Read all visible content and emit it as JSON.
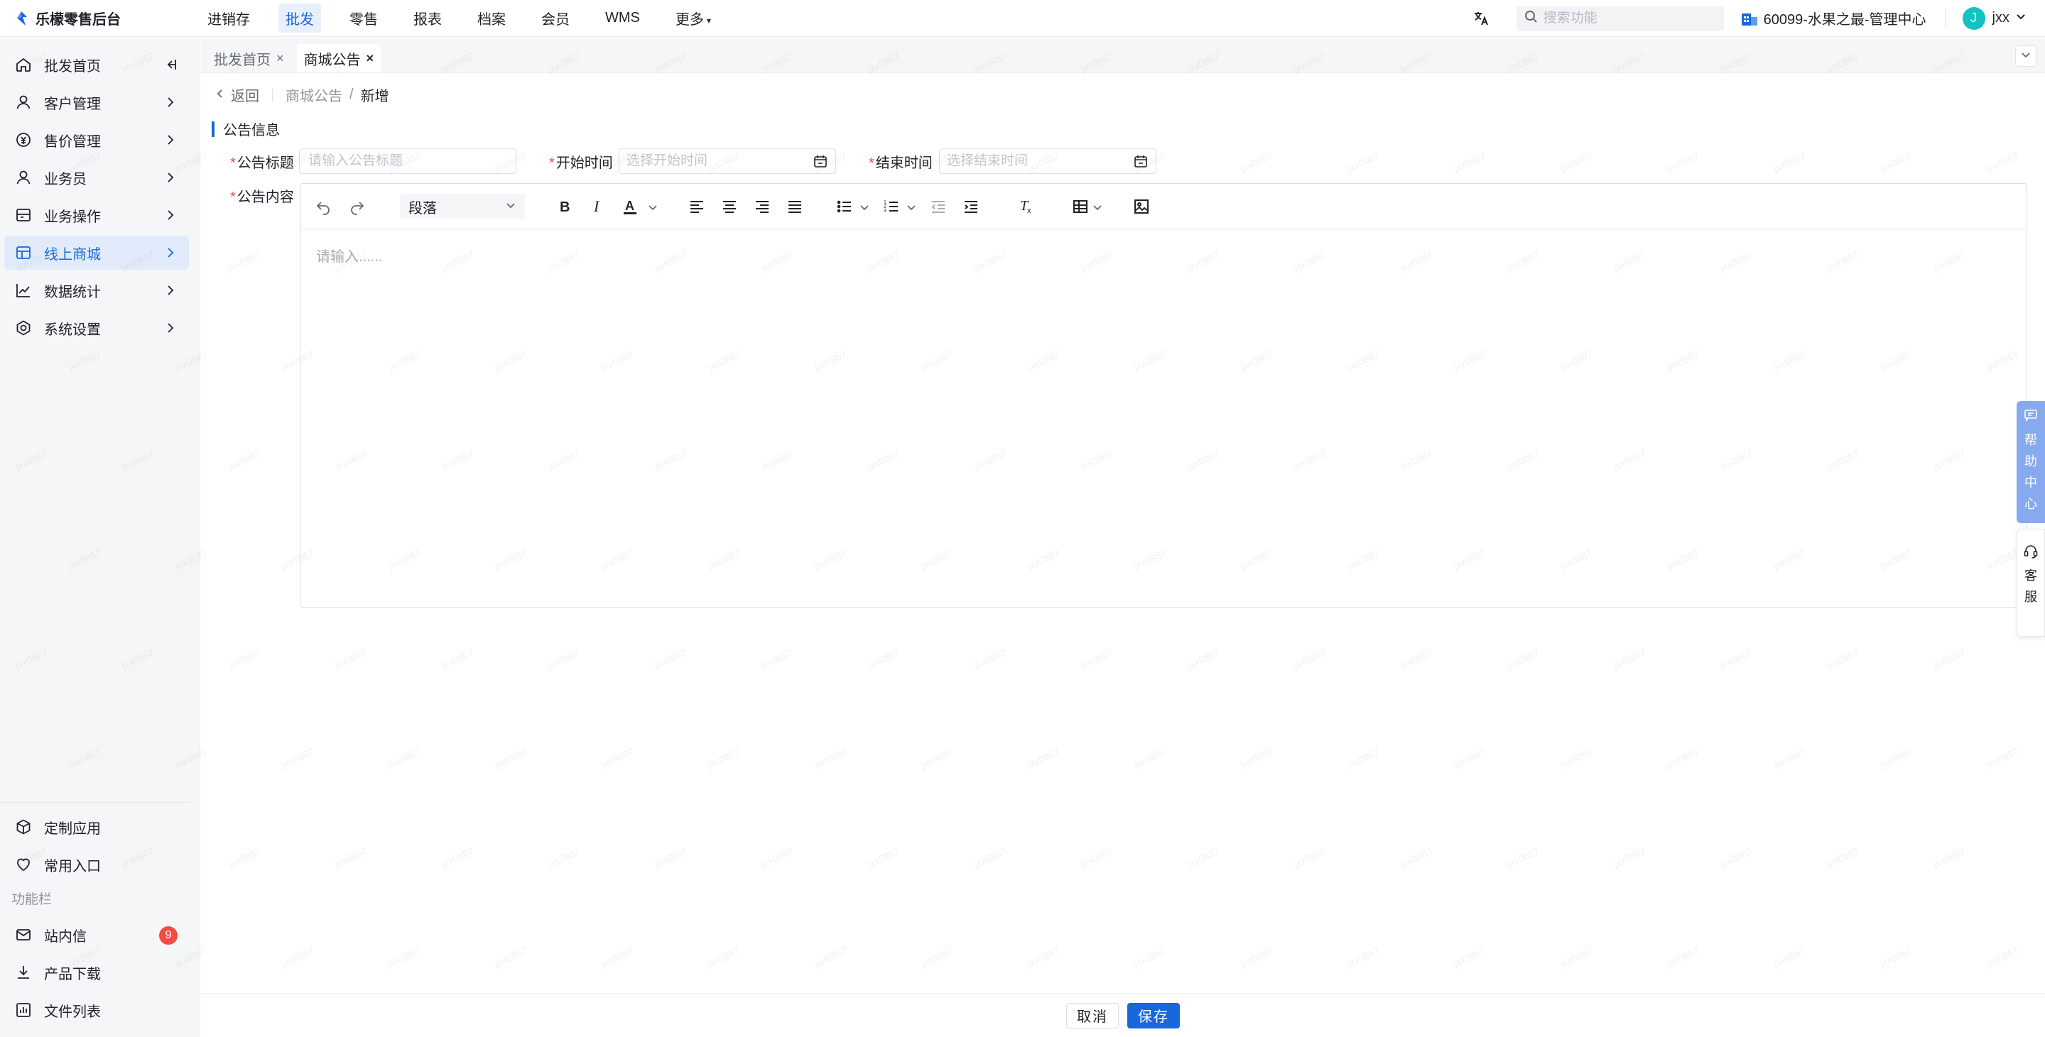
{
  "brand": {
    "name": "乐檬零售后台",
    "accent": "#1668dc"
  },
  "topnav": {
    "items": [
      {
        "label": "进销存"
      },
      {
        "label": "批发",
        "active": true
      },
      {
        "label": "零售"
      },
      {
        "label": "报表"
      },
      {
        "label": "档案"
      },
      {
        "label": "会员"
      },
      {
        "label": "WMS"
      },
      {
        "label": "更多"
      }
    ],
    "search_placeholder": "搜索功能",
    "org": "60099-水果之最-管理中心",
    "user_initial": "J",
    "user_name": "jxx"
  },
  "sidebar": {
    "items": [
      {
        "label": "批发首页",
        "icon": "home-icon"
      },
      {
        "label": "客户管理",
        "icon": "user-icon"
      },
      {
        "label": "售价管理",
        "icon": "price-icon"
      },
      {
        "label": "业务员",
        "icon": "person-icon"
      },
      {
        "label": "业务操作",
        "icon": "operation-icon"
      },
      {
        "label": "线上商城",
        "icon": "store-icon",
        "active": true
      },
      {
        "label": "数据统计",
        "icon": "chart-icon"
      },
      {
        "label": "系统设置",
        "icon": "settings-icon"
      }
    ],
    "bottom_items": [
      {
        "label": "定制应用",
        "icon": "cube-icon"
      },
      {
        "label": "常用入口",
        "icon": "heart-icon"
      }
    ],
    "section_label": "功能栏",
    "tool_items": [
      {
        "label": "站内信",
        "icon": "mail-icon",
        "badge": "9"
      },
      {
        "label": "产品下载",
        "icon": "download-icon"
      },
      {
        "label": "文件列表",
        "icon": "file-list-icon"
      }
    ]
  },
  "tabs": [
    {
      "label": "批发首页",
      "close": "×"
    },
    {
      "label": "商城公告",
      "close": "×",
      "active": true
    }
  ],
  "breadcrumb": {
    "back": "返回",
    "parent": "商城公告",
    "separator": "/",
    "current": "新增"
  },
  "form": {
    "section_title": "公告信息",
    "required_mark": "*",
    "title_label": "公告标题",
    "title_placeholder": "请输入公告标题",
    "start_label": "开始时间",
    "start_placeholder": "选择开始时间",
    "end_label": "结束时间",
    "end_placeholder": "选择结束时间",
    "content_label": "公告内容"
  },
  "editor": {
    "paragraph_format": "段落",
    "placeholder": "请输入......"
  },
  "floating": {
    "help_text": "帮助中心",
    "service_text": "客服"
  },
  "footer": {
    "cancel": "取消",
    "save": "保存"
  },
  "watermark": "jxx0867"
}
